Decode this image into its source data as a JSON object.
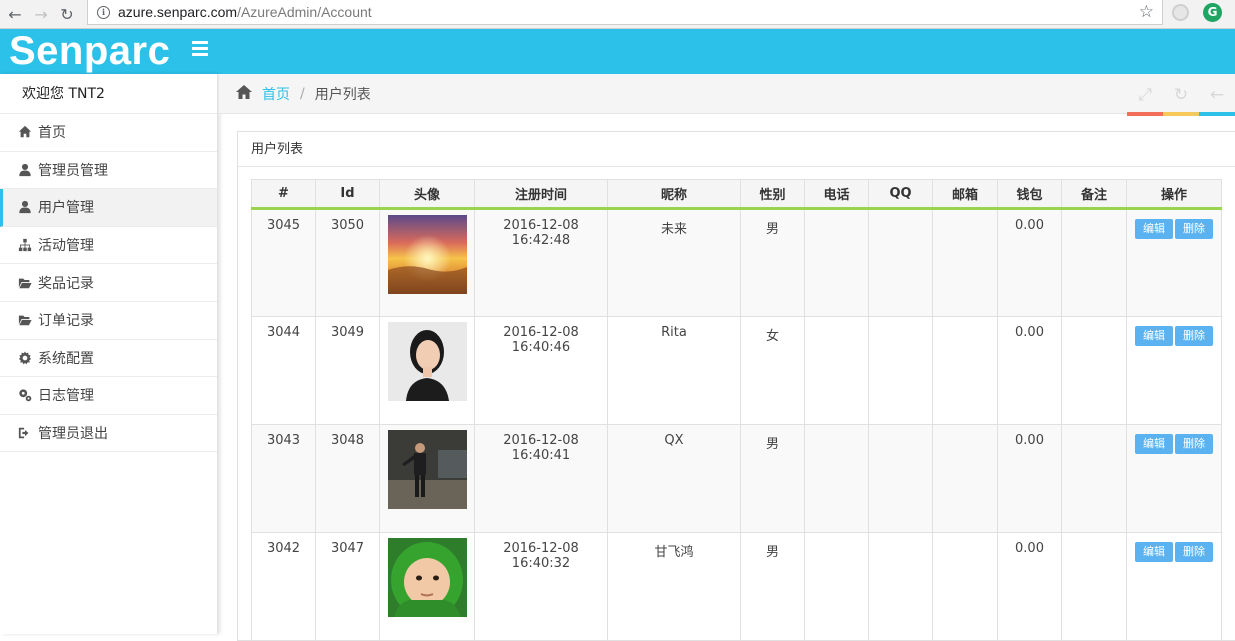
{
  "browser": {
    "url_host": "azure.senparc.com",
    "url_path": "/AzureAdmin/Account",
    "back_icon": "arrow-left-icon",
    "forward_icon": "arrow-right-icon",
    "reload_icon": "reload-icon",
    "star_icon": "star-icon"
  },
  "header": {
    "logo": "Senparc",
    "accent_color": "#2cc1e8"
  },
  "sidebar": {
    "welcome": "欢迎您 TNT2",
    "items": [
      {
        "label": "首页",
        "icon": "home-icon"
      },
      {
        "label": "管理员管理",
        "icon": "user-icon"
      },
      {
        "label": "用户管理",
        "icon": "user-icon",
        "active": true
      },
      {
        "label": "活动管理",
        "icon": "sitemap-icon"
      },
      {
        "label": "奖品记录",
        "icon": "folder-open-icon"
      },
      {
        "label": "订单记录",
        "icon": "folder-open-icon"
      },
      {
        "label": "系统配置",
        "icon": "gear-icon"
      },
      {
        "label": "日志管理",
        "icon": "gears-icon"
      },
      {
        "label": "管理员退出",
        "icon": "sign-out-icon"
      }
    ]
  },
  "breadcrumb": {
    "home": "首页",
    "separator": "/",
    "current": "用户列表"
  },
  "panel": {
    "title": "用户列表"
  },
  "table": {
    "headers": [
      "#",
      "Id",
      "头像",
      "注册时间",
      "昵称",
      "性别",
      "电话",
      "QQ",
      "邮箱",
      "钱包",
      "备注",
      "操作"
    ],
    "edit_label": "编辑",
    "delete_label": "删除",
    "rows": [
      {
        "num": "3045",
        "id": "3050",
        "avatar": "sunset-photo",
        "time": "2016-12-08 16:42:48",
        "nick": "未来",
        "gender": "男",
        "phone": "",
        "qq": "",
        "email": "",
        "wallet": "0.00",
        "note": ""
      },
      {
        "num": "3044",
        "id": "3049",
        "avatar": "woman-portrait-photo",
        "time": "2016-12-08 16:40:46",
        "nick": "Rita",
        "gender": "女",
        "phone": "",
        "qq": "",
        "email": "",
        "wallet": "0.00",
        "note": ""
      },
      {
        "num": "3043",
        "id": "3048",
        "avatar": "man-standing-photo",
        "time": "2016-12-08 16:40:41",
        "nick": "QX",
        "gender": "男",
        "phone": "",
        "qq": "",
        "email": "",
        "wallet": "0.00",
        "note": ""
      },
      {
        "num": "3042",
        "id": "3047",
        "avatar": "child-green-hood-photo",
        "time": "2016-12-08 16:40:32",
        "nick": "甘飞鸿",
        "gender": "男",
        "phone": "",
        "qq": "",
        "email": "",
        "wallet": "0.00",
        "note": ""
      }
    ]
  }
}
